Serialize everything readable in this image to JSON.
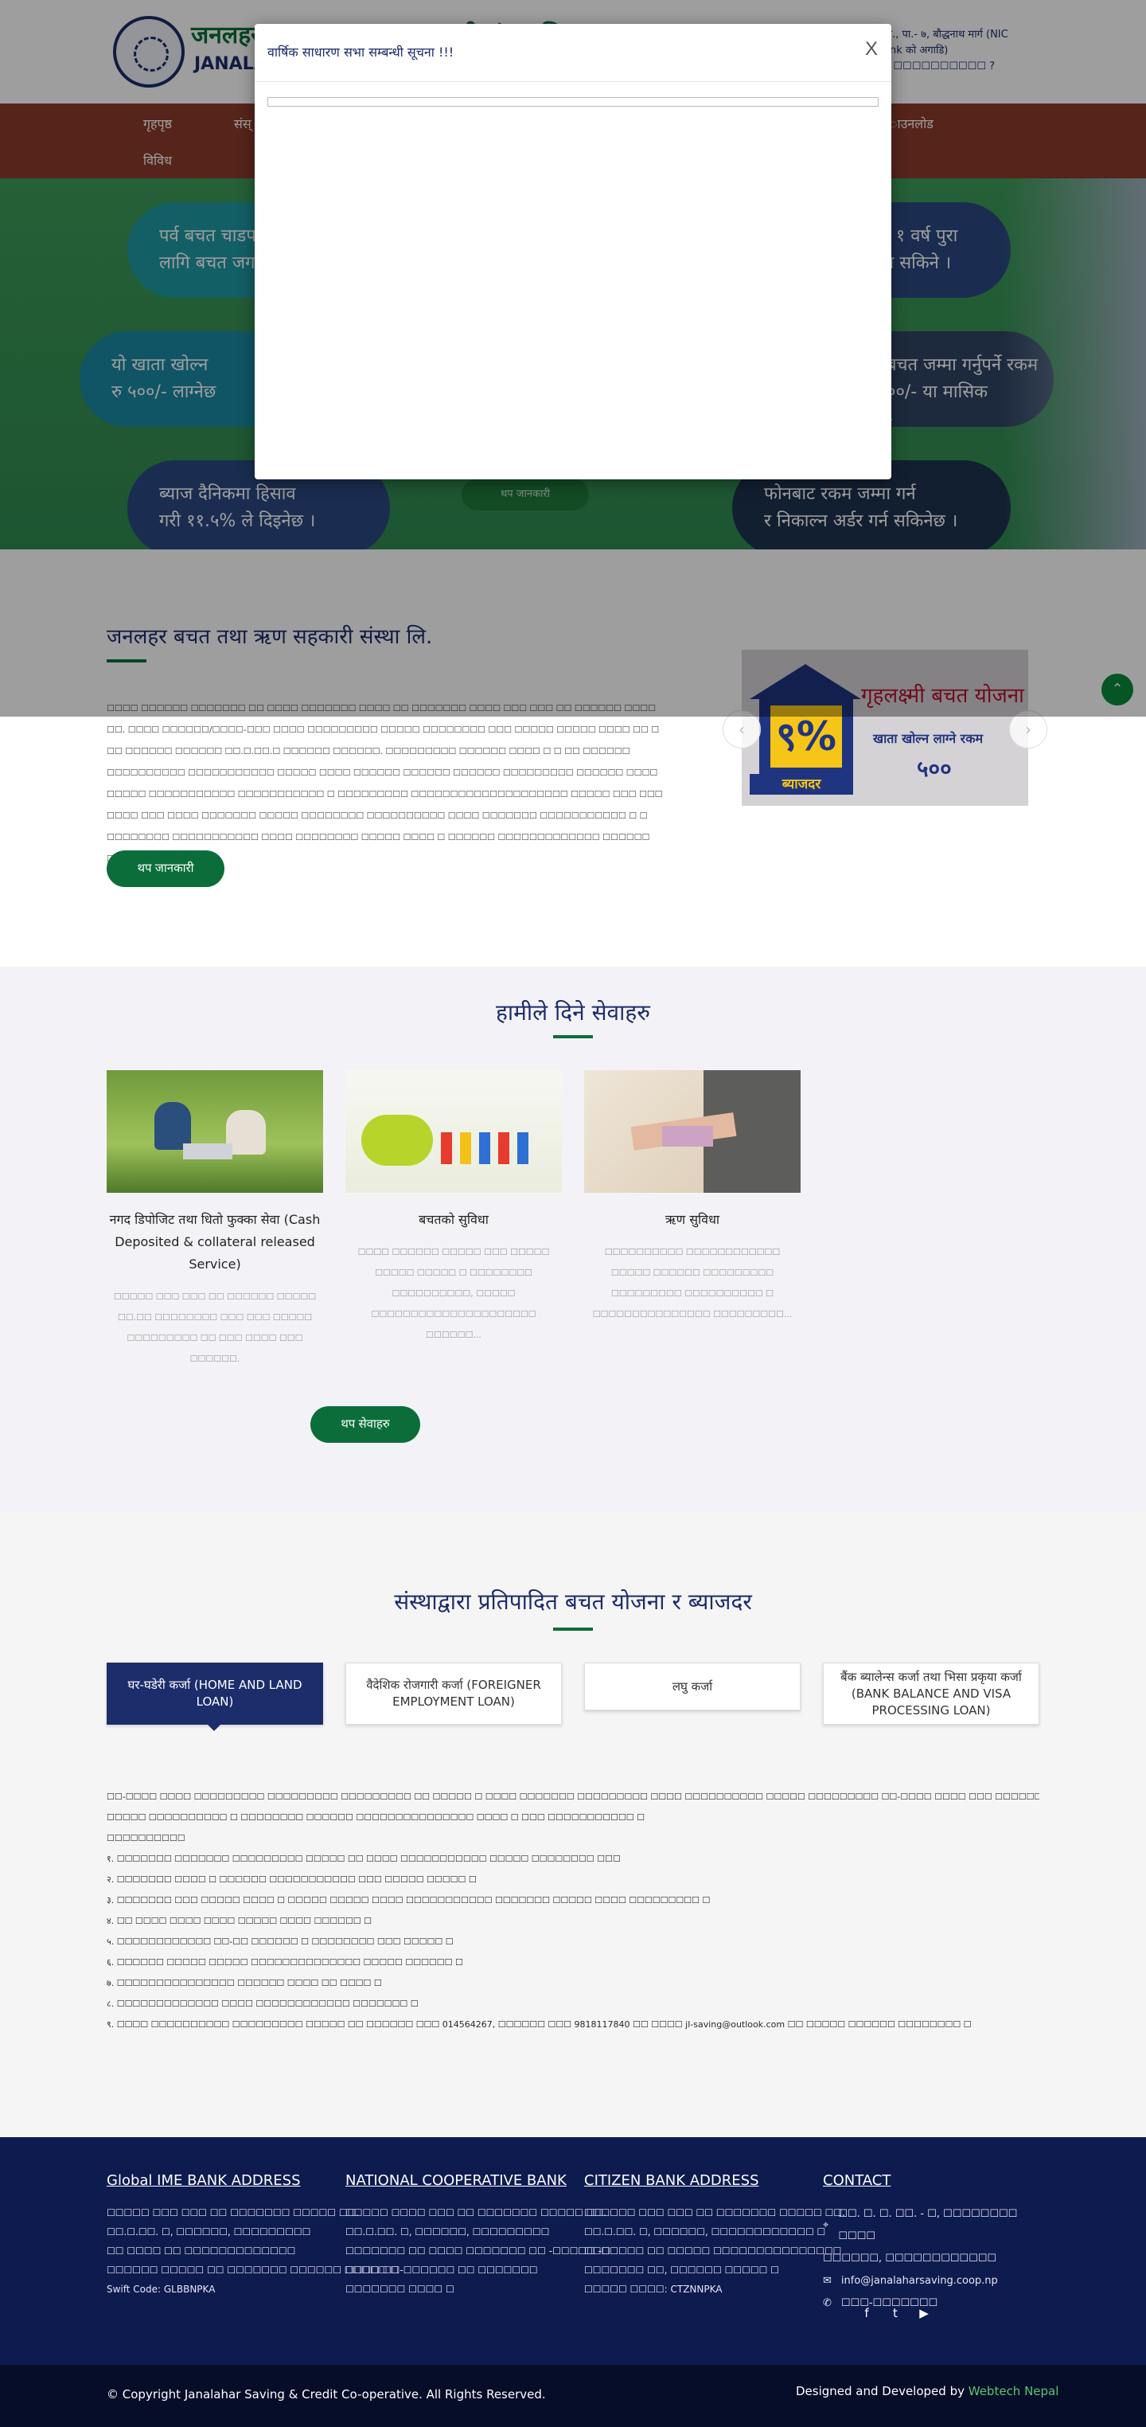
{
  "header": {
    "logo_name": "जनलहर बचत तथा ऋण सहकारी संस्था लि.",
    "logo_sub": "JANALAHAR",
    "contact_lines": [
      "ा., पा.- ७, बौद्धनाथ मार्ग (NIC",
      "ank को अगाडि)",
      "., ☐☐☐☐☐☐☐☐☐☐ ?"
    ]
  },
  "nav": {
    "items": [
      "गृहपृष्ठ",
      "संस्",
      "ाउनलोड",
      "विविध"
    ]
  },
  "hero": {
    "bubbles": [
      "पर्व बचत चाडप",
      "लागि बचत जग",
      "ा १ वर्ष पुरा",
      "ल्न सकिने ।",
      "यो खाता खोल्न",
      "रु ५००/- लाग्नेछ",
      "बचत जम्मा गर्नुपर्ने रकम",
      "००/- या मासिक",
      "-",
      "ब्याज दैनिकमा हिसाव",
      "गरी ११.५% ले दिइनेछ ।",
      "फोनबाट रकम जम्मा गर्न",
      "र निकाल्न अर्डर गर्न सकिनेछ ।"
    ],
    "more_label": "थप जानकारी"
  },
  "about": {
    "title": "जनलहर बचत तथा ऋण सहकारी संस्था लि.",
    "paragraph": "☐☐☐☐ ☐☐☐☐☐☐ ☐☐☐☐☐☐☐ ☐☐ ☐☐☐☐ ☐☐☐☐☐☐☐ ☐☐☐☐ ☐☐ ☐☐☐☐☐☐☐ ☐☐☐☐ ☐☐☐ ☐☐☐ ☐☐ ☐☐☐☐☐☐ ☐☐☐☐ ☐☐. ☐☐☐☐ ☐☐☐☐☐☐/☐☐☐☐-☐☐☐ ☐☐☐☐ ☐☐☐☐☐☐☐☐☐ ☐☐☐☐☐ ☐☐☐☐☐☐☐☐ ☐☐☐ ☐☐☐☐☐ ☐☐☐☐☐ ☐☐☐☐ ☐☐ ☐ ☐☐ ☐☐☐☐☐☐ ☐☐☐☐☐☐ ☐☐.☐.☐☐.☐ ☐☐☐☐☐☐ ☐☐☐☐☐☐. ☐☐☐☐☐☐☐☐☐ ☐☐☐☐☐☐ ☐☐☐☐ ☐ ☐ ☐☐ ☐☐☐☐☐☐ ☐☐☐☐☐☐☐☐☐☐ ☐☐☐☐☐☐☐☐☐☐☐ ☐☐☐☐☐ ☐☐☐☐ ☐☐☐☐☐☐ ☐☐☐☐☐☐ ☐☐☐☐☐☐ ☐☐☐☐☐☐☐☐☐ ☐☐☐☐☐☐ ☐☐☐☐ ☐☐☐☐☐ ☐☐☐☐☐☐☐☐☐☐☐ ☐☐☐☐☐☐☐☐☐☐☐ ☐ ☐☐☐☐☐☐☐☐☐ ☐☐☐☐☐☐☐☐☐☐☐☐☐☐☐☐☐☐☐☐ ☐☐☐☐☐ ☐☐☐ ☐☐☐ ☐☐☐☐ ☐☐☐ ☐☐☐☐ ☐☐☐☐☐☐☐ ☐☐☐☐☐ ☐☐☐☐☐☐☐☐ ☐☐☐☐☐☐☐☐☐☐ ☐☐☐☐ ☐☐☐☐☐☐☐ ☐☐☐☐☐☐☐☐☐☐☐ ☐ ☐ ☐☐☐☐☐☐☐☐ ☐☐☐☐☐☐☐☐☐☐☐ ☐☐☐☐ ☐☐☐☐☐☐☐☐ ☐☐☐☐☐ ☐☐☐☐ ☐ ☐☐☐☐☐☐ ☐☐☐☐☐☐☐☐☐☐☐☐☐ ☐☐☐☐☐☐ ☐☐☐☐☐☐ ☐ ☐",
    "button_label": "थप जानकारी"
  },
  "promo": {
    "rate": "९%",
    "rate_label": "ब्याजदर",
    "title": "गृहलक्ष्मी बचत योजना",
    "subtitle": "खाता खोल्न लाग्ने रकम",
    "amount": "५००"
  },
  "services": {
    "title": "हामीले दिने सेवाहरु",
    "cards": [
      {
        "name": "नगद डिपोजिट तथा धितो फुक्का सेवा (Cash Deposited & collateral released Service)",
        "desc": "☐☐☐☐☐ ☐☐☐ ☐☐☐ ☐☐ ☐☐☐☐☐☐ ☐☐☐☐☐ ☐☐.☐☐ ☐☐☐☐☐☐☐☐ ☐☐☐ ☐☐☐ ☐☐☐☐☐ ☐☐☐☐☐☐☐☐☐ ☐☐ ☐☐☐ ☐☐☐☐ ☐☐☐ ☐☐☐☐☐☐."
      },
      {
        "name": "बचतको सुविधा",
        "desc": "☐☐☐☐ ☐☐☐☐☐☐ ☐☐☐☐☐ ☐☐☐ ☐☐☐☐☐ ☐☐☐☐☐ ☐☐☐☐☐ ☐ ☐☐☐☐☐☐☐☐ ☐☐☐☐☐☐☐☐☐☐, ☐☐☐☐☐ ☐☐☐☐☐☐☐☐☐☐☐☐☐☐☐☐☐☐☐☐☐ ☐☐☐☐☐☐..."
      },
      {
        "name": "ऋण सुविधा",
        "desc": "☐☐☐☐☐☐☐☐☐☐ ☐☐☐☐☐☐☐☐☐☐☐☐ ☐☐☐☐☐ ☐☐☐☐☐☐ ☐☐☐☐☐☐☐☐☐ ☐☐☐☐☐☐☐☐☐ ☐☐☐☐☐☐☐☐☐☐ ☐ ☐☐☐☐☐☐☐☐☐☐☐☐☐☐☐ ☐☐☐☐☐☐☐☐☐..."
      }
    ],
    "button_label": "थप सेवाहरु"
  },
  "loans": {
    "title": "संस्थाद्वारा प्रतिपादित बचत योजना र ब्याजदर",
    "tabs": [
      "घर-घडेरी कर्जा (HOME AND LAND LOAN)",
      "वैदेशिक रोजगारी कर्जा (FOREIGNER EMPLOYMENT LOAN)",
      "लघु कर्जा",
      "बैंक ब्यालेन्स कर्जा तथा भिसा प्रकृया कर्जा (BANK BALANCE AND VISA PROCESSING LOAN)"
    ],
    "body_lines": [
      "☐☐-☐☐☐☐ ☐☐☐☐ ☐☐☐☐☐☐☐☐☐ ☐☐☐☐☐☐☐☐☐ ☐☐☐☐☐☐☐☐☐ ☐☐ ☐☐☐☐☐ ☐ ☐☐☐☐ ☐☐☐☐☐☐☐ ☐☐☐☐☐☐☐☐☐ ☐☐☐☐ ☐☐☐☐☐☐☐☐☐☐ ☐☐☐☐☐ ☐☐☐☐☐☐☐☐☐ ☐☐-☐☐☐☐ ☐☐☐☐ ☐☐☐ ☐☐☐☐☐☐☐☐ ☐☐☐☐☐☐ ☐☐☐☐☐☐☐ ☐☐☐☐☐☐☐☐☐☐☐",
      "☐☐☐☐☐ ☐☐☐☐☐☐☐☐☐☐ ☐ ☐☐☐☐☐☐☐☐ ☐☐☐☐☐☐ ☐☐☐☐☐☐☐☐☐☐☐☐☐☐☐ ☐☐☐☐ ☐ ☐☐☐ ☐☐☐☐☐☐☐☐☐☐☐ ☐",
      "☐☐☐☐☐☐☐☐☐☐",
      "१. ☐☐☐☐☐☐☐ ☐☐☐☐☐☐☐ ☐☐☐☐☐☐☐☐☐ ☐☐☐☐☐ ☐☐ ☐☐☐☐ ☐☐☐☐☐☐☐☐☐☐☐ ☐☐☐☐☐ ☐☐☐☐☐☐☐☐ ☐☐☐",
      "२. ☐☐☐☐☐☐☐ ☐☐☐☐ ☐ ☐☐☐☐☐☐ ☐☐☐☐☐☐☐☐☐☐☐ ☐☐☐ ☐☐☐☐☐ ☐☐☐☐☐ ☐",
      "३. ☐☐☐☐☐☐☐ ☐☐☐ ☐☐☐☐☐ ☐☐☐☐ ☐ ☐☐☐☐☐ ☐☐☐☐☐ ☐☐☐☐ ☐☐☐☐☐☐☐☐☐☐☐ ☐☐☐☐☐☐☐ ☐☐☐☐☐ ☐☐☐☐ ☐☐☐☐☐☐☐☐☐ ☐",
      "४. ☐☐ ☐☐☐☐ ☐☐☐☐ ☐☐☐☐ ☐☐☐☐☐  ☐☐☐☐ ☐☐☐☐☐☐ ☐",
      "५. ☐☐☐☐☐☐☐☐☐☐☐☐ ☐☐-☐☐ ☐☐☐☐☐☐ ☐ ☐☐☐☐☐☐☐☐ ☐☐☐ ☐☐☐☐☐ ☐",
      "६. ☐☐☐☐☐☐ ☐☐☐☐☐ ☐☐☐☐☐ ☐☐☐☐☐☐☐☐☐☐☐☐☐☐ ☐☐☐☐☐ ☐☐☐☐☐☐ ☐",
      "७. ☐☐☐☐☐☐☐☐☐☐☐☐☐☐☐ ☐☐☐☐☐☐ ☐☐☐☐ ☐☐ ☐☐☐☐ ☐",
      "८. ☐☐☐☐☐☐☐☐☐☐☐☐☐ ☐☐☐☐ ☐☐☐☐☐☐☐☐☐☐☐☐ ☐☐☐☐☐☐☐ ☐",
      "९. ☐☐☐☐ ☐☐☐☐☐☐☐☐☐☐ ☐☐☐☐☐☐☐☐☐ ☐☐☐☐☐ ☐☐ ☐☐☐☐☐☐ ☐☐☐ 014564267, ☐☐☐☐☐☐ ☐☐☐ 9818117840 ☐☐ ☐☐☐☐ jl-saving@outlook.com  ☐☐ ☐☐☐☐☐ ☐☐☐☐☐☐ ☐☐☐☐☐☐☐☐ ☐"
    ]
  },
  "footer": {
    "columns": [
      {
        "heading": "Global IME BANK ADDRESS",
        "lines": [
          "☐☐☐☐☐ ☐☐☐ ☐☐☐ ☐☐ ☐☐☐☐☐☐☐ ☐☐☐☐☐ ☐☐.",
          "☐☐.☐.☐☐. ☐, ☐☐☐☐☐☐, ☐☐☐☐☐☐☐☐☐",
          "☐☐ ☐☐☐☐ ☐☐ ☐☐☐☐☐☐☐☐☐☐☐☐☐",
          "☐☐☐☐☐☐ ☐☐☐☐☐ ☐☐ ☐☐☐☐☐☐☐ ☐☐☐☐☐☐ ☐☐☐☐☐ ☐",
          "Swift Code: GLBBNPKA"
        ]
      },
      {
        "heading": "NATIONAL COOPERATIVE BANK",
        "lines": [
          "☐☐☐☐☐ ☐☐☐☐ ☐☐☐ ☐☐ ☐☐☐☐☐☐☐ ☐☐☐☐☐ ☐☐.",
          "☐☐.☐.☐☐. ☐, ☐☐☐☐☐☐, ☐☐☐☐☐☐☐☐☐",
          "☐☐☐☐☐☐☐ ☐☐ ☐☐☐☐ ☐☐☐☐☐☐☐ ☐☐ -☐☐☐☐☐ -☐",
          "☐☐☐☐ ☐☐-☐☐☐☐☐☐ ☐☐ ☐☐☐☐☐☐☐",
          "☐☐☐☐☐☐☐ ☐☐☐☐ ☐"
        ]
      },
      {
        "heading": "CITIZEN BANK ADDRESS",
        "lines": [
          "☐☐☐☐☐☐ ☐☐☐ ☐☐☐ ☐☐ ☐☐☐☐☐☐☐ ☐☐☐☐☐ ☐☐.",
          "☐☐.☐.☐☐. ☐, ☐☐☐☐☐☐, ☐☐☐☐☐☐☐☐☐☐☐☐ ☐",
          "☐☐☐☐☐☐☐ ☐☐ ☐☐☐☐☐ ☐☐☐☐☐☐☐☐☐☐☐☐☐☐☐",
          "☐☐☐☐☐☐☐ ☐☐, ☐☐☐☐☐☐ ☐☐☐☐☐ ☐",
          "☐☐☐☐☐ ☐☐☐☐: CTZNNPKA"
        ]
      },
      {
        "heading": "CONTACT",
        "lines": [
          "☐☐. ☐. ☐. ☐☐. - ☐, ☐☐☐☐☐☐☐☐ ☐☐☐☐",
          "☐☐☐☐☐☐, ☐☐☐☐☐☐☐☐☐☐☐☐",
          "info@janalaharsaving.coop.np",
          "☐☐☐-☐☐☐☐☐☐☐"
        ]
      }
    ],
    "copyright": "© Copyright Janalahar Saving & Credit Co-operative. All Rights Reserved.",
    "designed_by": "Designed and Developed by",
    "developer": "Webtech Nepal"
  },
  "modal": {
    "title": "वार्षिक साधारण सभा सम्बन्धी सूचना !!!",
    "close_label": "X"
  }
}
